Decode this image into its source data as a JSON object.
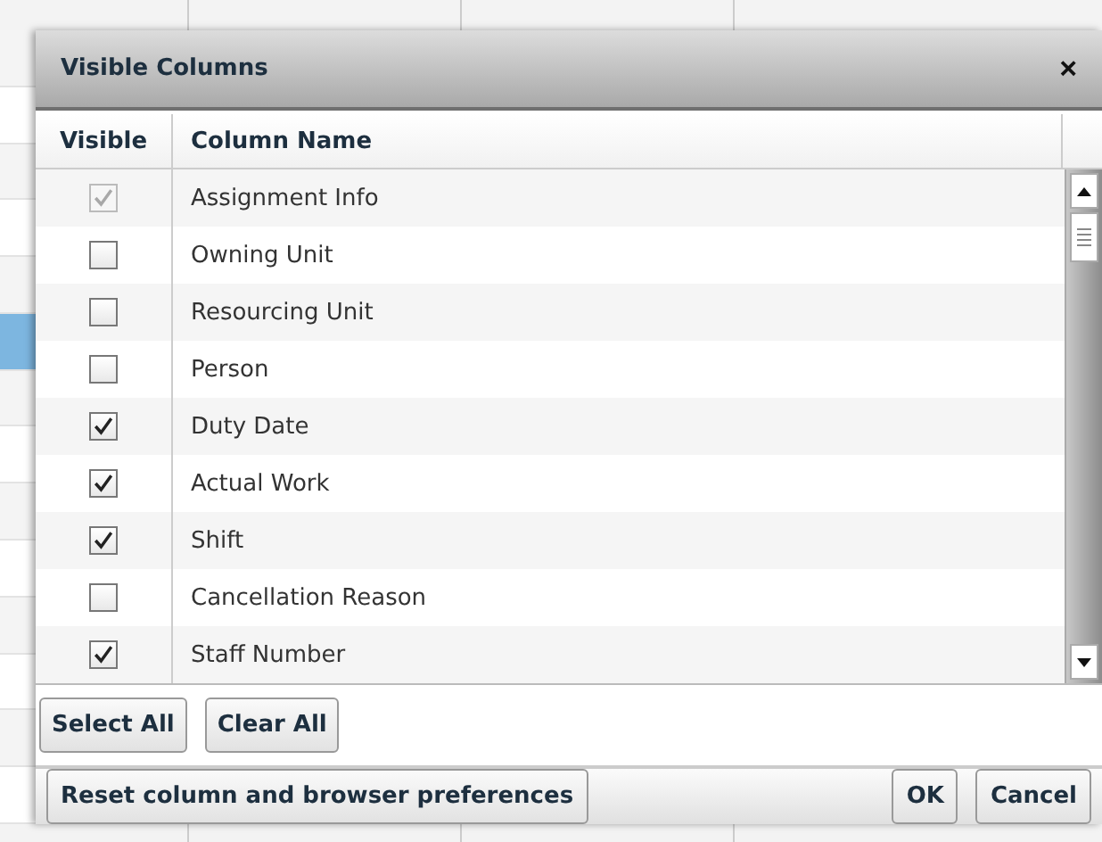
{
  "dialog": {
    "title": "Visible Columns",
    "close": "×"
  },
  "table": {
    "columns": [
      "Visible",
      "Column Name"
    ],
    "rows": [
      {
        "name": "Assignment Info",
        "checked": true,
        "disabled": true
      },
      {
        "name": "Owning Unit",
        "checked": false,
        "disabled": false
      },
      {
        "name": "Resourcing Unit",
        "checked": false,
        "disabled": false
      },
      {
        "name": "Person",
        "checked": false,
        "disabled": false
      },
      {
        "name": "Duty Date",
        "checked": true,
        "disabled": false
      },
      {
        "name": "Actual Work",
        "checked": true,
        "disabled": false
      },
      {
        "name": "Shift",
        "checked": true,
        "disabled": false
      },
      {
        "name": "Cancellation Reason",
        "checked": false,
        "disabled": false
      },
      {
        "name": "Staff Number",
        "checked": true,
        "disabled": false
      }
    ]
  },
  "selection_buttons": [
    "Select All",
    "Clear All"
  ],
  "footer": {
    "reset": "Reset column and browser preferences",
    "buttons": [
      "OK",
      "Cancel"
    ]
  }
}
